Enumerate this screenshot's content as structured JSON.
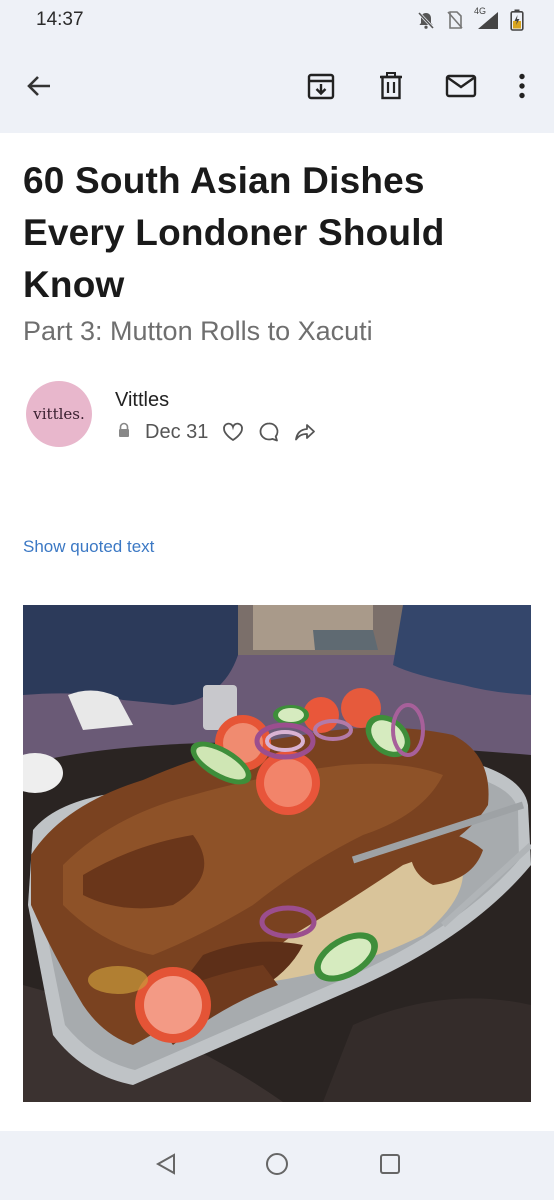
{
  "status_bar": {
    "time": "14:37",
    "icons": [
      "notifications-off-icon",
      "no-sim-icon",
      "signal-4g-icon",
      "battery-charging-icon"
    ],
    "network_label": "4G"
  },
  "app_bar": {
    "buttons": [
      "back-arrow-icon",
      "archive-icon",
      "delete-icon",
      "mark-unread-icon",
      "more-options-icon"
    ]
  },
  "email": {
    "title": "60 South Asian Dishes Every Londoner Should Know",
    "subtitle": "Part 3: Mutton Rolls to Xacuti",
    "sender": {
      "avatar_text": "vittles.",
      "avatar_color": "#e8b7cc",
      "name": "Vittles"
    },
    "date": "Dec 31",
    "meta_icons": [
      "lock-icon",
      "heart-icon",
      "comment-icon",
      "share-icon"
    ],
    "show_quoted_text": "Show quoted text",
    "image": {
      "description_icon": "food-photo",
      "subject": "roast lamb on rice with tomato, cucumber and onion slices on a metal tray"
    }
  },
  "nav_bar": {
    "buttons": [
      "back-triangle-icon",
      "home-circle-icon",
      "recents-square-icon"
    ]
  },
  "colors": {
    "chrome_background": "#eef1f7",
    "link": "#3b78c4"
  }
}
